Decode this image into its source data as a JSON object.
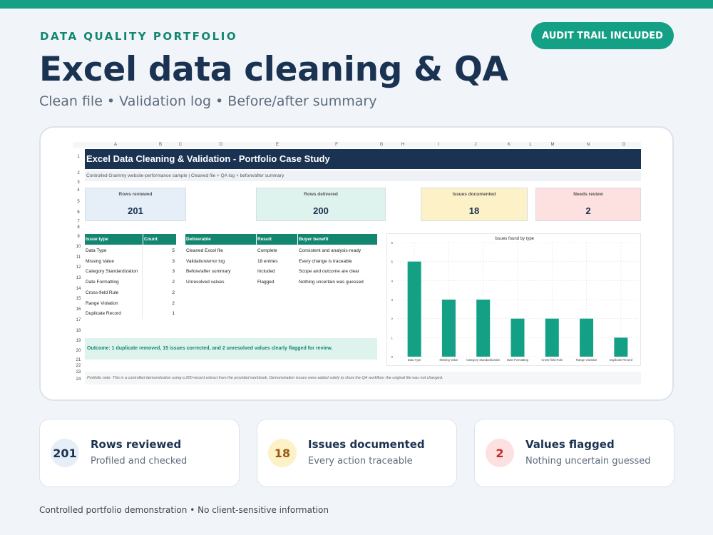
{
  "header": {
    "eyebrow": "DATA QUALITY PORTFOLIO",
    "badge": "AUDIT TRAIL INCLUDED",
    "title": "Excel data cleaning & QA",
    "subtitle": "Clean file • Validation log • Before/after summary"
  },
  "sheet": {
    "columns": [
      "A",
      "B",
      "C",
      "D",
      "E",
      "F",
      "G",
      "H",
      "I",
      "J",
      "K",
      "L",
      "M",
      "N",
      "O"
    ],
    "rows": [
      "1",
      "2",
      "3",
      "4",
      "5",
      "6",
      "7",
      "8",
      "9",
      "10",
      "11",
      "12",
      "13",
      "14",
      "15",
      "16",
      "17",
      "18",
      "19",
      "20",
      "21",
      "22",
      "23",
      "24"
    ],
    "banner": "Excel Data Cleaning & Validation - Portfolio Case Study",
    "subline": "Controlled Grammy website-performance sample | Cleaned file + QA log + before/after summary",
    "kpis": [
      {
        "label": "Rows reviewed",
        "value": "201",
        "color": "#e6eef7"
      },
      {
        "label": "Rows delivered",
        "value": "200",
        "color": "#dff3ee"
      },
      {
        "label": "Issues documented",
        "value": "18",
        "color": "#fdf1c7"
      },
      {
        "label": "Needs review",
        "value": "2",
        "color": "#fde0e0"
      }
    ],
    "issue_table": {
      "headers": [
        "Issue type",
        "Count"
      ],
      "rows": [
        [
          "Data Type",
          "5"
        ],
        [
          "Missing Value",
          "3"
        ],
        [
          "Category Standardization",
          "3"
        ],
        [
          "Date Formatting",
          "2"
        ],
        [
          "Cross-field Rule",
          "2"
        ],
        [
          "Range Violation",
          "2"
        ],
        [
          "Duplicate Record",
          "1"
        ]
      ]
    },
    "deliverable_table": {
      "headers": [
        "Deliverable",
        "Result",
        "Buyer benefit"
      ],
      "rows": [
        [
          "Cleaned Excel file",
          "Complete",
          "Consistent and analysis-ready"
        ],
        [
          "Validation/error log",
          "18 entries",
          "Every change is traceable"
        ],
        [
          "Before/after summary",
          "Included",
          "Scope and outcome are clear"
        ],
        [
          "Unresolved values",
          "Flagged",
          "Nothing uncertain was guessed"
        ]
      ]
    },
    "outcome": "Outcome: 1 duplicate removed, 15 issues corrected, and 2 unresolved values clearly flagged for review.",
    "note": "Portfolio note: This is a controlled demonstration using a 200-record extract from the provided workbook. Demonstration issues were added solely to show the QA workflow; the original file was not changed."
  },
  "chart_data": {
    "type": "bar",
    "title": "Issues found by type",
    "categories": [
      "Data Type",
      "Missing Value",
      "Category Standardization",
      "Date Formatting",
      "Cross-field Rule",
      "Range Violation",
      "Duplicate Record"
    ],
    "values": [
      5,
      3,
      3,
      2,
      2,
      2,
      1
    ],
    "ylim": [
      0,
      6
    ],
    "yticks": [
      "0",
      "1",
      "2",
      "3",
      "4",
      "5",
      "6"
    ],
    "grid": true,
    "bar_color": "#14a085"
  },
  "stats": [
    {
      "value": "201",
      "title": "Rows reviewed",
      "sub": "Profiled and checked",
      "bg": "#e6eef7",
      "fg": "#1b3352"
    },
    {
      "value": "18",
      "title": "Issues documented",
      "sub": "Every action traceable",
      "bg": "#fdf1c7",
      "fg": "#9a5a10"
    },
    {
      "value": "2",
      "title": "Values flagged",
      "sub": "Nothing uncertain guessed",
      "bg": "#fde0e0",
      "fg": "#c62828"
    }
  ],
  "footer": "Controlled portfolio demonstration • No client-sensitive information"
}
